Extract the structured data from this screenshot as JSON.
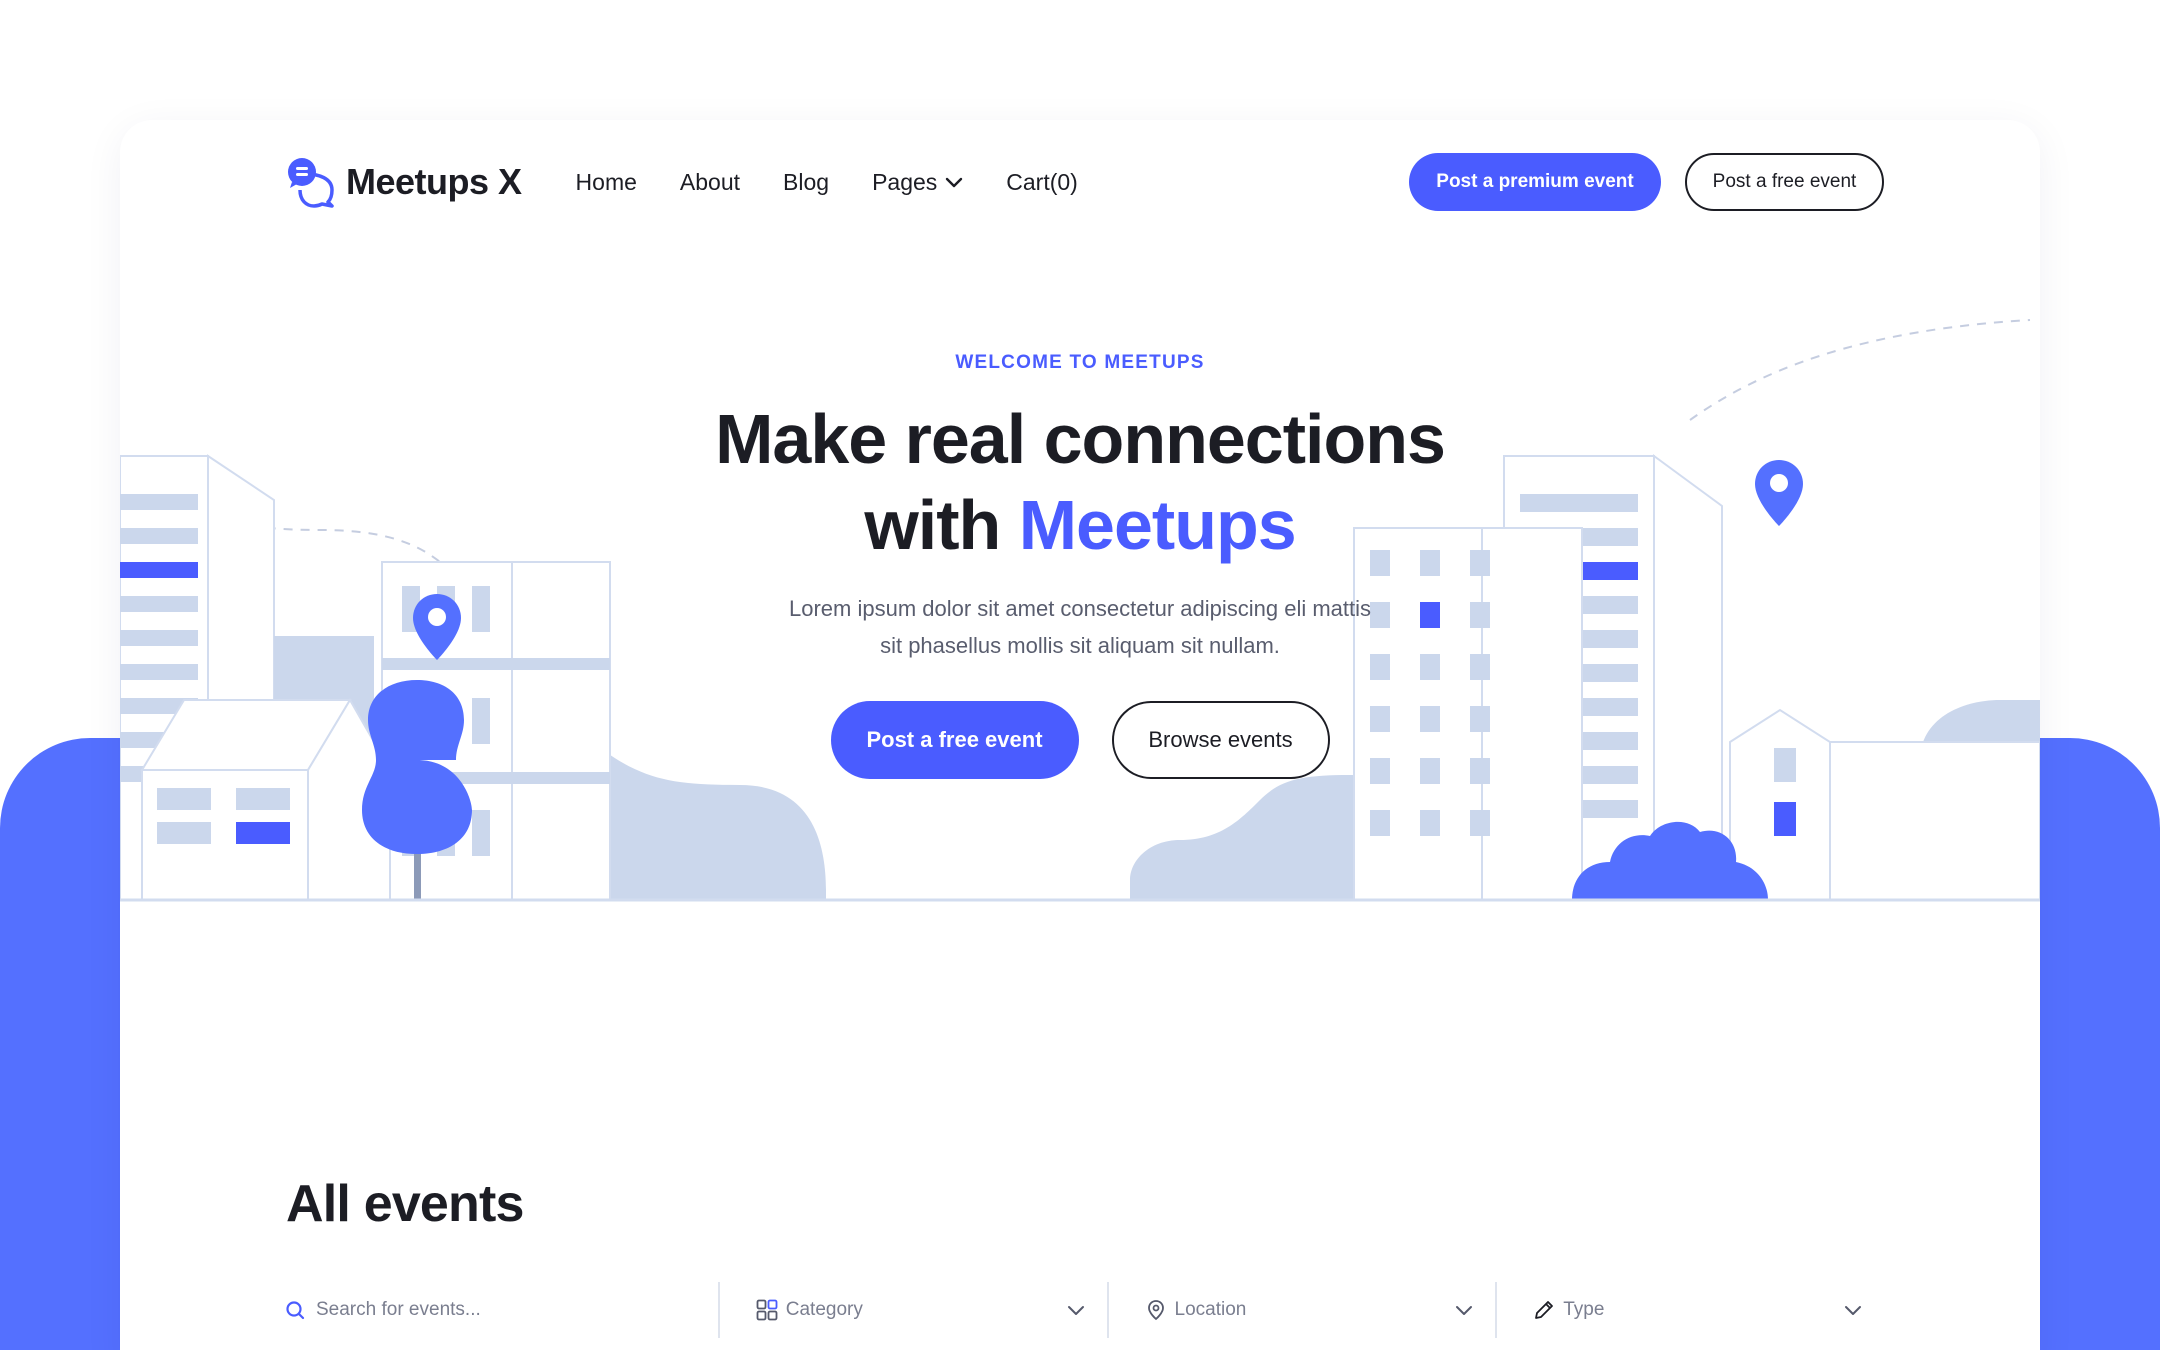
{
  "brand": {
    "name": "Meetups X"
  },
  "nav": {
    "items": [
      {
        "label": "Home"
      },
      {
        "label": "About"
      },
      {
        "label": "Blog"
      },
      {
        "label": "Pages"
      },
      {
        "label": "Cart(0)"
      }
    ]
  },
  "header_buttons": {
    "premium": "Post a premium event",
    "free": "Post a free event"
  },
  "hero": {
    "eyebrow": "WELCOME TO MEETUPS",
    "headline_line1": "Make real connections",
    "headline_with": "with",
    "headline_accent": "Meetups",
    "lead": "Lorem ipsum dolor sit amet consectetur adipiscing eli mattis sit phasellus mollis sit aliquam sit nullam.",
    "primary_button": "Post a free event",
    "secondary_button": "Browse events"
  },
  "events": {
    "title": "All events",
    "search_placeholder": "Search for events...",
    "filters": [
      {
        "label": "Category",
        "icon": "grid-icon"
      },
      {
        "label": "Location",
        "icon": "map-pin-icon"
      },
      {
        "label": "Type",
        "icon": "pencil-icon"
      }
    ]
  },
  "colors": {
    "accent": "#4a5cff",
    "background_blue": "#5470ff",
    "illustration_light": "#cbd7ec",
    "text_dark": "#1c1d24"
  }
}
